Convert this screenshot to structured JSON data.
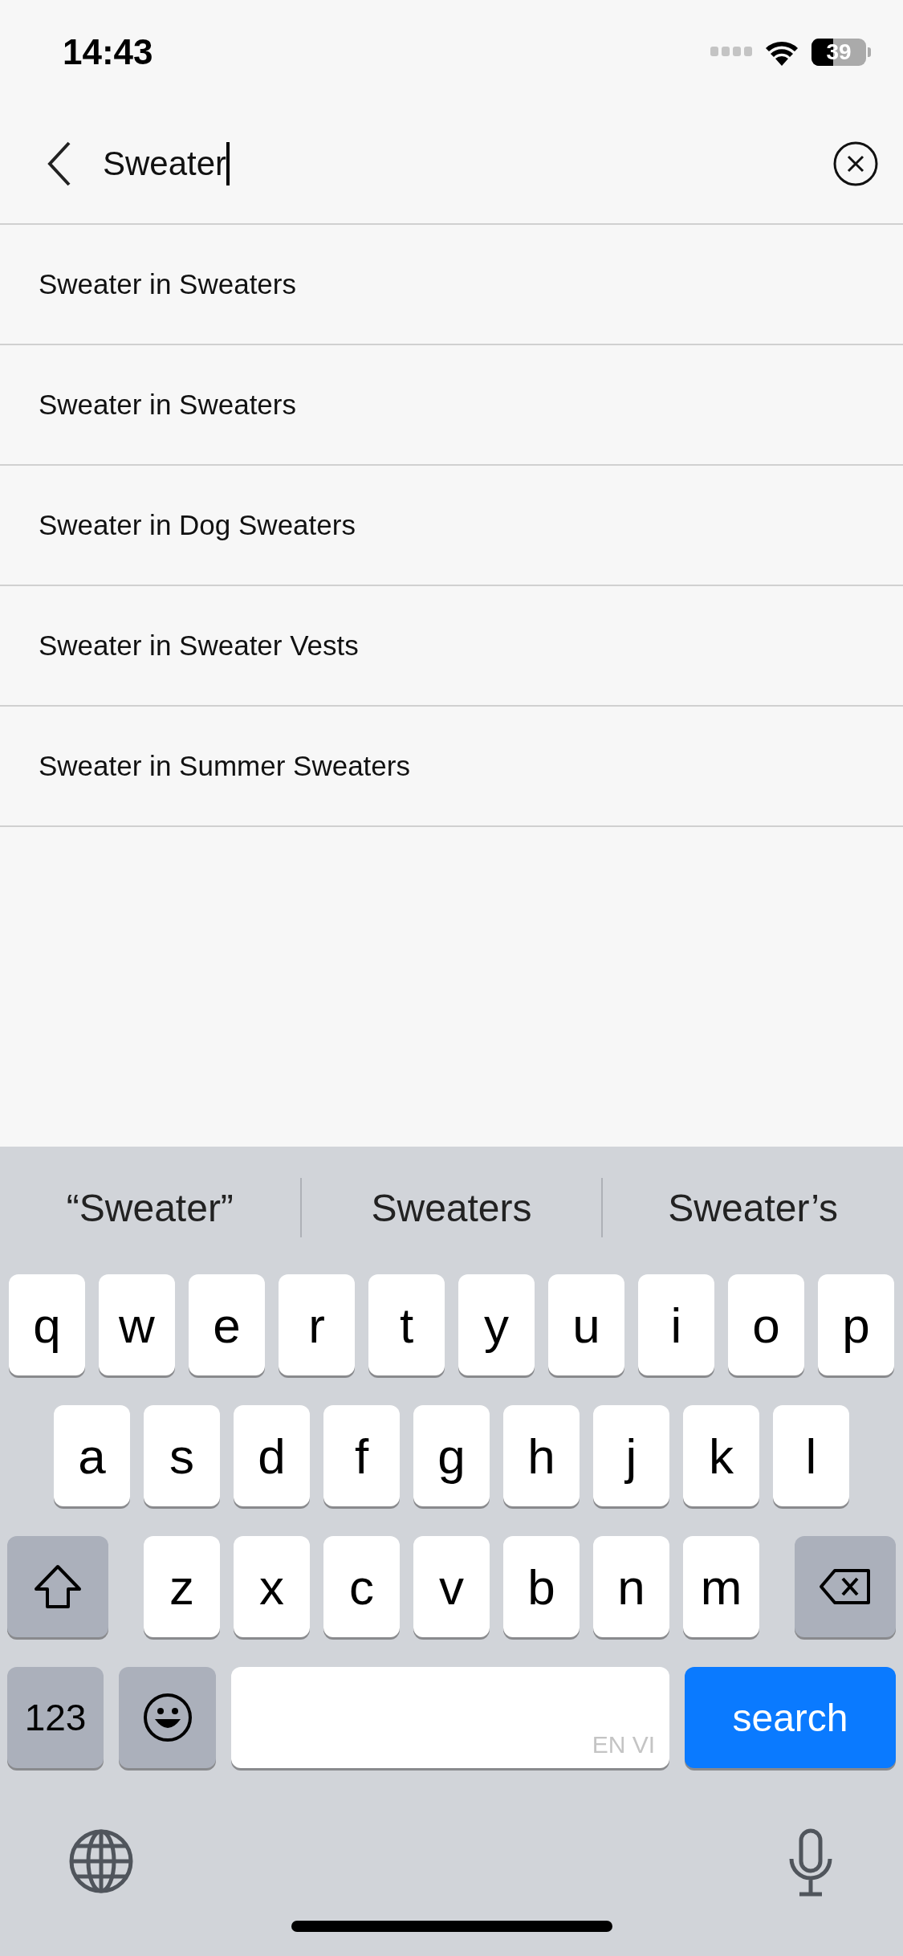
{
  "status_bar": {
    "time": "14:43",
    "battery": "39"
  },
  "search": {
    "value": "Sweater"
  },
  "results": [
    {
      "label": "Sweater in Sweaters"
    },
    {
      "label": "Sweater in Sweaters"
    },
    {
      "label": "Sweater in Dog Sweaters"
    },
    {
      "label": "Sweater in Sweater Vests"
    },
    {
      "label": "Sweater in Summer Sweaters"
    }
  ],
  "keyboard": {
    "suggestions": [
      "“Sweater”",
      "Sweaters",
      "Sweater’s"
    ],
    "rows": [
      [
        "q",
        "w",
        "e",
        "r",
        "t",
        "y",
        "u",
        "i",
        "o",
        "p"
      ],
      [
        "a",
        "s",
        "d",
        "f",
        "g",
        "h",
        "j",
        "k",
        "l"
      ],
      [
        "z",
        "x",
        "c",
        "v",
        "b",
        "n",
        "m"
      ]
    ],
    "numbers_key": "123",
    "space_label": "EN VI",
    "action_key": "search"
  }
}
